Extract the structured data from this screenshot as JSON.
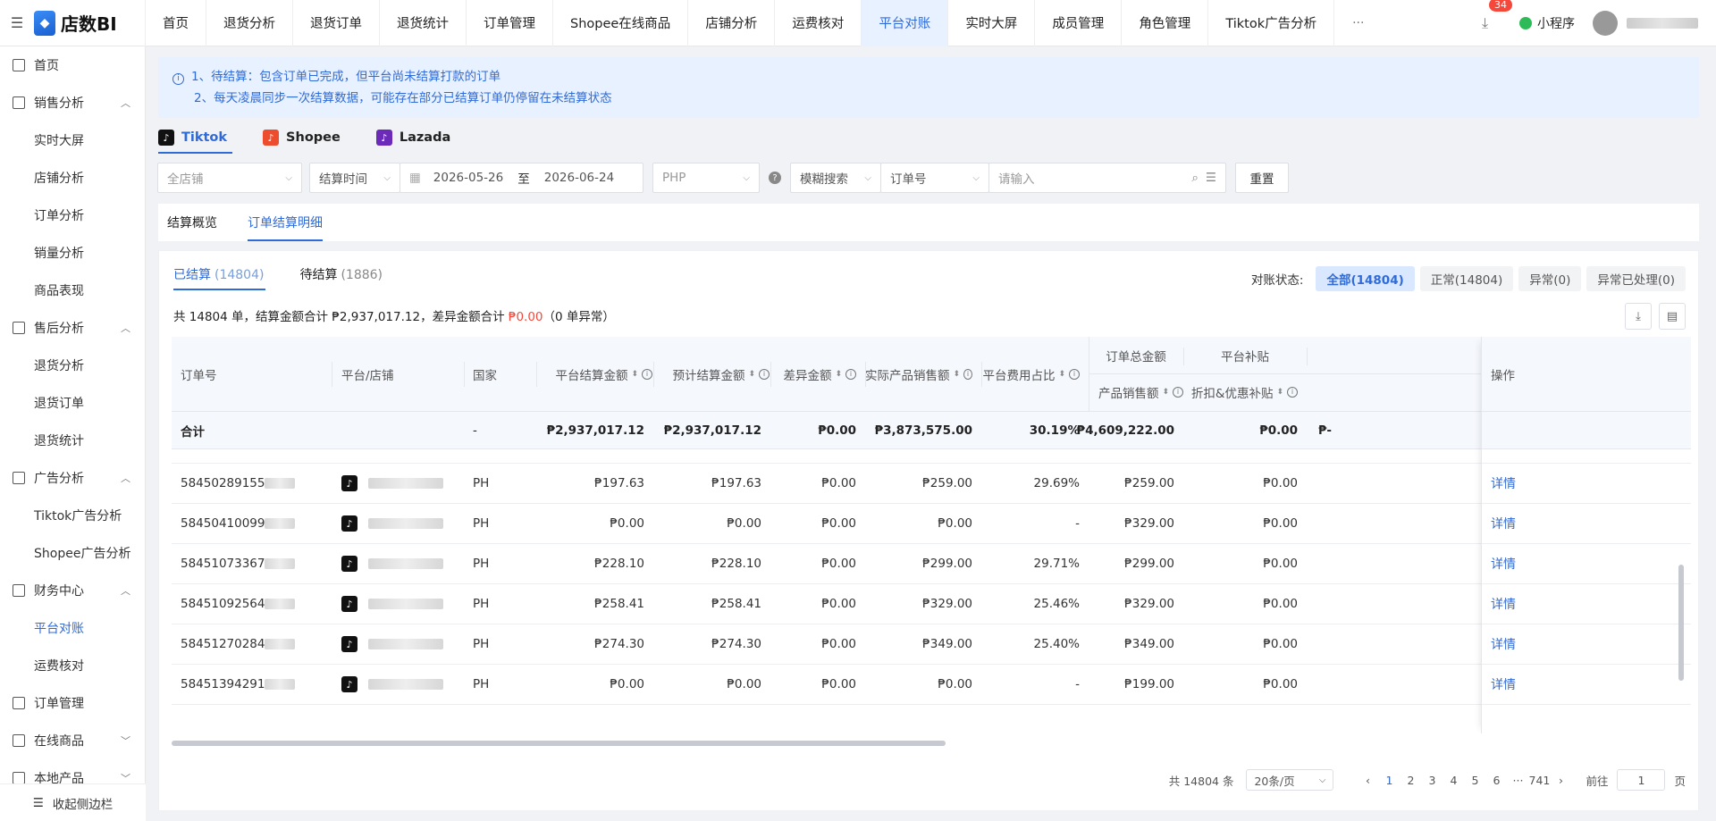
{
  "app": {
    "logo_text": "店数BI"
  },
  "topnav": {
    "items": [
      "首页",
      "退货分析",
      "退货订单",
      "退货统计",
      "订单管理",
      "Shopee在线商品",
      "店铺分析",
      "运费核对",
      "平台对账",
      "实时大屏",
      "成员管理",
      "角色管理",
      "Tiktok广告分析"
    ],
    "active_index": 8,
    "more": "···",
    "badge_count": "34",
    "mini_program": "小程序"
  },
  "sidebar": {
    "items": [
      {
        "label": "首页",
        "type": "top",
        "icon": "home-icon"
      },
      {
        "label": "销售分析",
        "type": "group",
        "icon": "chart-icon",
        "chevron": "︿"
      },
      {
        "label": "实时大屏",
        "type": "sub"
      },
      {
        "label": "店铺分析",
        "type": "sub"
      },
      {
        "label": "订单分析",
        "type": "sub"
      },
      {
        "label": "销量分析",
        "type": "sub"
      },
      {
        "label": "商品表现",
        "type": "sub"
      },
      {
        "label": "售后分析",
        "type": "group",
        "icon": "refund-icon",
        "chevron": "︿"
      },
      {
        "label": "退货分析",
        "type": "sub"
      },
      {
        "label": "退货订单",
        "type": "sub"
      },
      {
        "label": "退货统计",
        "type": "sub"
      },
      {
        "label": "广告分析",
        "type": "group",
        "icon": "ad-icon",
        "chevron": "︿"
      },
      {
        "label": "Tiktok广告分析",
        "type": "sub"
      },
      {
        "label": "Shopee广告分析",
        "type": "sub"
      },
      {
        "label": "财务中心",
        "type": "group",
        "icon": "finance-icon",
        "chevron": "︿"
      },
      {
        "label": "平台对账",
        "type": "sub",
        "active": true
      },
      {
        "label": "运费核对",
        "type": "sub"
      },
      {
        "label": "订单管理",
        "type": "top",
        "icon": "order-icon"
      },
      {
        "label": "在线商品",
        "type": "group",
        "icon": "product-icon",
        "chevron": "﹀"
      },
      {
        "label": "本地产品",
        "type": "group",
        "icon": "local-icon",
        "chevron": "﹀"
      }
    ],
    "collapse_label": "收起侧边栏"
  },
  "notice": {
    "line1": "1、待结算：包含订单已完成，但平台尚未结算打款的订单",
    "line2": "2、每天凌晨同步一次结算数据，可能存在部分已结算订单仍停留在未结算状态"
  },
  "platform_tabs": [
    {
      "label": "Tiktok",
      "color": "#111111"
    },
    {
      "label": "Shopee",
      "color": "#ee4d2d"
    },
    {
      "label": "Lazada",
      "color": "#6b2bb8"
    }
  ],
  "filters": {
    "shop_placeholder": "全店铺",
    "time_type": "结算时间",
    "date_start": "2026-05-26",
    "date_to": "至",
    "date_end": "2026-06-24",
    "currency": "PHP",
    "search_mode": "模糊搜索",
    "search_field": "订单号",
    "search_placeholder": "请输入",
    "reset_label": "重置"
  },
  "sub_tabs": [
    "结算概览",
    "订单结算明细"
  ],
  "settle_tabs": [
    {
      "label": "已结算",
      "count": "(14804)"
    },
    {
      "label": "待结算",
      "count": "(1886)"
    }
  ],
  "recon": {
    "label": "对账状态:",
    "buttons": [
      "全部(14804)",
      "正常(14804)",
      "异常(0)",
      "异常已处理(0)"
    ]
  },
  "summary": {
    "prefix": "共 14804 单，结算金额合计 ₱2,937,017.12，差异金额合计 ",
    "diff": "₱0.00",
    "suffix": "（0 单异常）"
  },
  "table": {
    "headers": {
      "order_no": "订单号",
      "shop": "平台/店铺",
      "country": "国家",
      "settle_amt": "平台结算金额",
      "est_amt": "预计结算金额",
      "diff_amt": "差异金额",
      "actual_sales": "实际产品销售额",
      "fee_ratio": "平台费用占比",
      "order_total": "订单总金额",
      "product_sales": "产品销售额",
      "platform_subsidy": "平台补贴",
      "discount_subsidy": "折扣&优惠补贴",
      "op": "操作"
    },
    "total": {
      "label": "合计",
      "country": "-",
      "settle_amt": "₱2,937,017.12",
      "est_amt": "₱2,937,017.12",
      "diff_amt": "₱0.00",
      "actual_sales": "₱3,873,575.00",
      "fee_ratio": "30.19%",
      "product_sales": "₱4,609,222.00",
      "discount_subsidy": "₱0.00",
      "cutoff": "₱-"
    },
    "rows": [
      {
        "order_no": "58450289155",
        "country": "PH",
        "settle_amt": "₱197.63",
        "est_amt": "₱197.63",
        "diff_amt": "₱0.00",
        "actual_sales": "₱259.00",
        "fee_ratio": "29.69%",
        "product_sales": "₱259.00",
        "discount_subsidy": "₱0.00",
        "op": "详情"
      },
      {
        "order_no": "58450410099",
        "country": "PH",
        "settle_amt": "₱0.00",
        "est_amt": "₱0.00",
        "diff_amt": "₱0.00",
        "actual_sales": "₱0.00",
        "fee_ratio": "-",
        "product_sales": "₱329.00",
        "discount_subsidy": "₱0.00",
        "op": "详情"
      },
      {
        "order_no": "58451073367",
        "country": "PH",
        "settle_amt": "₱228.10",
        "est_amt": "₱228.10",
        "diff_amt": "₱0.00",
        "actual_sales": "₱299.00",
        "fee_ratio": "29.71%",
        "product_sales": "₱299.00",
        "discount_subsidy": "₱0.00",
        "op": "详情"
      },
      {
        "order_no": "58451092564",
        "country": "PH",
        "settle_amt": "₱258.41",
        "est_amt": "₱258.41",
        "diff_amt": "₱0.00",
        "actual_sales": "₱329.00",
        "fee_ratio": "25.46%",
        "product_sales": "₱329.00",
        "discount_subsidy": "₱0.00",
        "op": "详情"
      },
      {
        "order_no": "58451270284",
        "country": "PH",
        "settle_amt": "₱274.30",
        "est_amt": "₱274.30",
        "diff_amt": "₱0.00",
        "actual_sales": "₱349.00",
        "fee_ratio": "25.40%",
        "product_sales": "₱349.00",
        "discount_subsidy": "₱0.00",
        "op": "详情"
      },
      {
        "order_no": "58451394291",
        "country": "PH",
        "settle_amt": "₱0.00",
        "est_amt": "₱0.00",
        "diff_amt": "₱0.00",
        "actual_sales": "₱0.00",
        "fee_ratio": "-",
        "product_sales": "₱199.00",
        "discount_subsidy": "₱0.00",
        "op": "详情"
      }
    ]
  },
  "pager": {
    "total": "共 14804 条",
    "page_size": "20条/页",
    "prev": "‹",
    "pages": [
      "1",
      "2",
      "3",
      "4",
      "5",
      "6",
      "···",
      "741"
    ],
    "next": "›",
    "goto_label": "前往",
    "goto_value": "1",
    "page_suffix": "页"
  },
  "colors": {
    "accent": "#2f6bd8",
    "danger": "#f5483b"
  }
}
